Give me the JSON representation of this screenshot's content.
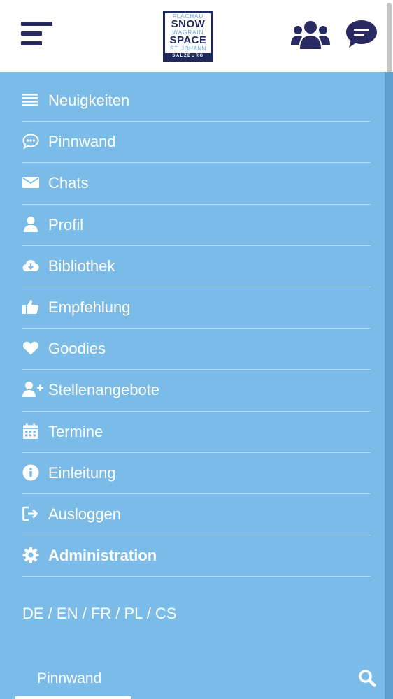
{
  "header": {
    "logo": {
      "line1": "FLACHAU",
      "line2": "SNOW",
      "line3": "WAGRAIN",
      "line4": "SPACE",
      "line5": "ST. JOHANN",
      "line6": "SALZBURG"
    },
    "icons": [
      "menu-icon",
      "users-icon",
      "chat-icon"
    ]
  },
  "menu": {
    "items": [
      {
        "label": "Neuigkeiten",
        "icon": "list-icon"
      },
      {
        "label": "Pinnwand",
        "icon": "comment-dots-icon"
      },
      {
        "label": "Chats",
        "icon": "envelope-icon"
      },
      {
        "label": "Profil",
        "icon": "user-icon"
      },
      {
        "label": "Bibliothek",
        "icon": "cloud-download-icon"
      },
      {
        "label": "Empfehlung",
        "icon": "thumbs-up-icon"
      },
      {
        "label": "Goodies",
        "icon": "heart-icon"
      },
      {
        "label": "Stellenangebote",
        "icon": "user-plus-icon"
      },
      {
        "label": "Termine",
        "icon": "calendar-icon"
      },
      {
        "label": "Einleitung",
        "icon": "info-icon"
      },
      {
        "label": "Ausloggen",
        "icon": "sign-out-icon"
      },
      {
        "label": "Administration",
        "icon": "gear-icon"
      }
    ]
  },
  "languages": {
    "de": "DE",
    "en": "EN",
    "fr": "FR",
    "pl": "PL",
    "cs": "CS",
    "separator": " / "
  },
  "bottom": {
    "tab_label": "Pinnwand",
    "search_icon": "search-icon"
  },
  "colors": {
    "navy": "#2a2a63",
    "menu_bg": "#7bbbe8",
    "divider": "#b9dbf3",
    "text": "#ffffff"
  }
}
